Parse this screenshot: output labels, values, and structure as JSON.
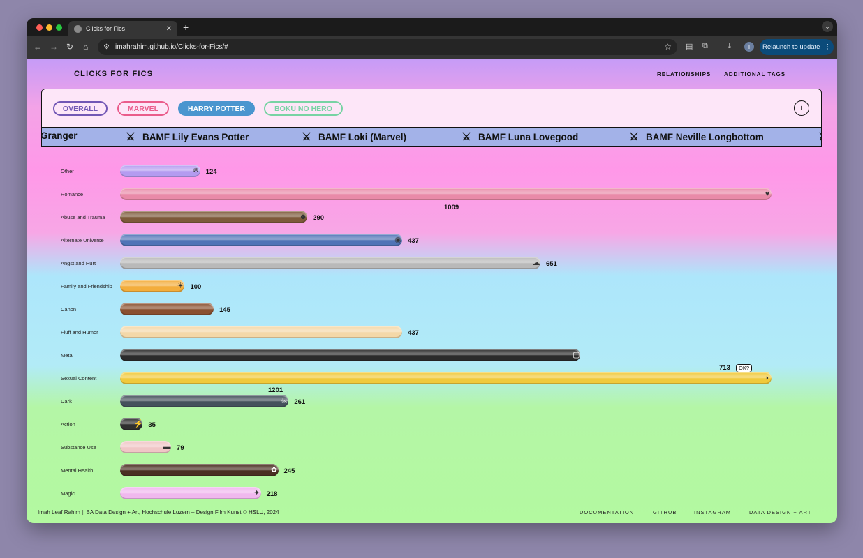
{
  "browser": {
    "tab_title": "Clicks for Fics",
    "url": "imahrahim.github.io/Clicks-for-Fics/#",
    "profile_initial": "I",
    "relaunch_label": "Relaunch to update"
  },
  "header": {
    "logo": "CLICKS FOR FICS",
    "nav": [
      "RELATIONSHIPS",
      "ADDITIONAL TAGS"
    ]
  },
  "filters": {
    "pills": [
      "OVERALL",
      "MARVEL",
      "HARRY POTTER",
      "BOKU NO HERO"
    ],
    "selected": "HARRY POTTER",
    "info_label": "i"
  },
  "ticker": [
    "Granger",
    "BAMF Lily Evans Potter",
    "BAMF Loki (Marvel)",
    "BAMF Luna Lovegood",
    "BAMF Neville Longbottom"
  ],
  "chart_data": {
    "type": "bar",
    "orientation": "horizontal",
    "categories": [
      "Other",
      "Romance",
      "Abuse and Trauma",
      "Alternate Universe",
      "Angst and Hurt",
      "Family and Friendship",
      "Canon",
      "Fluff and Humor",
      "Meta",
      "Sexual Content",
      "Dark",
      "Action",
      "Substance Use",
      "Mental Health",
      "Magic"
    ],
    "values": [
      124,
      1009,
      290,
      437,
      651,
      100,
      145,
      437,
      713,
      1201,
      261,
      35,
      79,
      245,
      218
    ],
    "colors": [
      "#b49bf0",
      "#e98aa8",
      "#7d5a3a",
      "#4f73b6",
      "#b9b9b9",
      "#f3ad3c",
      "#8a5030",
      "#f4d8a8",
      "#2b2b2b",
      "#f0c93b",
      "#45515c",
      "#2f2f2f",
      "#f0c6c6",
      "#4a2f22",
      "#f0b8ee"
    ],
    "icons": [
      "crystal-icon",
      "heart-icon",
      "head-icon",
      "globe-icon",
      "cloud-icon",
      "sun-icon",
      "",
      "",
      "window-icon",
      "banana-icon",
      "skull-icon",
      "lightning-icon",
      "cigarette-icon",
      "butterfly-icon",
      "wand-icon"
    ],
    "annotation": "OK?",
    "xlabel": "",
    "ylabel": ""
  },
  "footer": {
    "credit": "Imah Leaf Rahim || BA Data Design + Art, Hochschule Luzern – Design Film Kunst © HSLU, 2024",
    "links": [
      "DOCUMENTATION",
      "GITHUB",
      "INSTAGRAM",
      "DATA DESIGN + ART"
    ]
  }
}
